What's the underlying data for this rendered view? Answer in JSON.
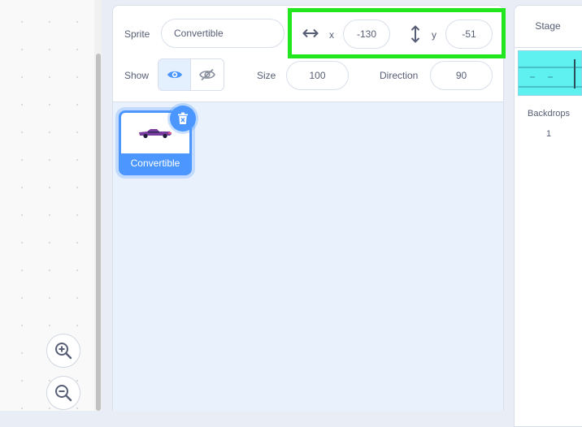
{
  "sprite_info": {
    "sprite_label": "Sprite",
    "sprite_name": "Convertible",
    "x_label": "x",
    "x_value": "-130",
    "y_label": "y",
    "y_value": "-51",
    "show_label": "Show",
    "size_label": "Size",
    "size_value": "100",
    "direction_label": "Direction",
    "direction_value": "90"
  },
  "sprites": [
    {
      "name": "Convertible",
      "selected": true
    }
  ],
  "stage": {
    "title": "Stage",
    "backdrops_label": "Backdrops",
    "backdrops_count": "1"
  },
  "colors": {
    "accent": "#4c97ff",
    "highlight": "#22e61e",
    "stage_backdrop": "#5ff0f0"
  },
  "icons": {
    "zoom_in": "zoom-in-icon",
    "zoom_out": "zoom-out-icon",
    "show_visible": "eye-icon",
    "show_hidden": "eye-slash-icon",
    "x_arrow": "horizontal-arrows-icon",
    "y_arrow": "vertical-arrows-icon",
    "delete": "trash-icon"
  }
}
